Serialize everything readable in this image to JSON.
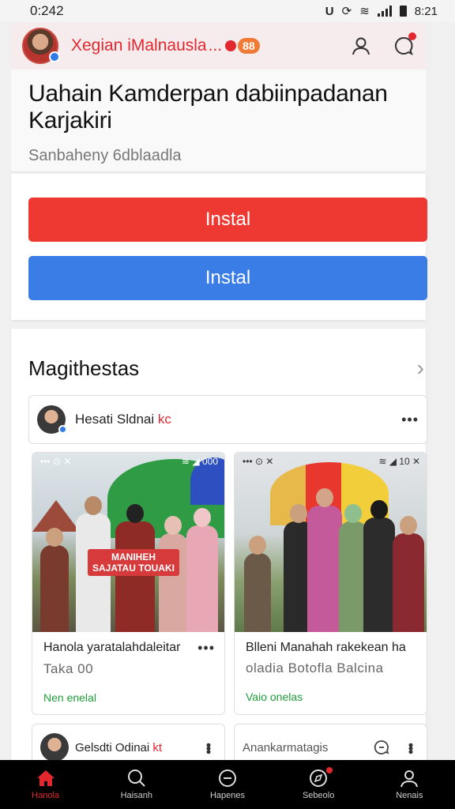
{
  "status_bar": {
    "time": "0:242",
    "clock": "8:21"
  },
  "header": {
    "title": "Xegian iMalnausla",
    "ellipsis": "...",
    "count": "88"
  },
  "article": {
    "title": "Uahain Kamderpan dabiinpadanan Karjakiri",
    "subtitle": "Sanbaheny 6dblaadla"
  },
  "install": {
    "primary_label": "Instal",
    "secondary_label": "Instal"
  },
  "section": {
    "title": "Magithestas",
    "feed_author": "Hesati Sldnai",
    "feed_author_tag": "kc",
    "more": "•••"
  },
  "posts": [
    {
      "overlay_top": "MANIHEH",
      "overlay_bottom": "SAJATAU TOUAKI",
      "text": "Hanola yaratalahdaleitar",
      "meta": "Taka  00",
      "link": "Nen enelal",
      "more": "•••",
      "status_left": "••• ⊙ ✕",
      "status_right": "≋ ◢ 000"
    },
    {
      "overlay_top": "",
      "overlay_bottom": "",
      "text": "Blleni Manahah rakekean  ha",
      "meta": "oladia  Botofla  Balcina",
      "link": "Vaio onelas",
      "more": "",
      "status_left": "••• ⊙ ✕",
      "status_right": "≋ ◢ 10 ✕"
    }
  ],
  "mini_cards": {
    "left_name": "Gelsdti Odinai",
    "left_tag": "kt",
    "right_text": "Anankarmatagis"
  },
  "bottom_nav": [
    {
      "label": "Hanola",
      "icon": "home-icon",
      "active": true
    },
    {
      "label": "Haisanh",
      "icon": "search-icon",
      "active": false
    },
    {
      "label": "Hapenes",
      "icon": "minus-circle-icon",
      "active": false
    },
    {
      "label": "Sebeolo",
      "icon": "compass-icon",
      "active": false
    },
    {
      "label": "Nenais",
      "icon": "profile-icon",
      "active": false
    }
  ],
  "colors": {
    "accent_red": "#e2282e",
    "install_red": "#ee3832",
    "install_blue": "#3b7de6",
    "link_green": "#1f9c3a"
  }
}
